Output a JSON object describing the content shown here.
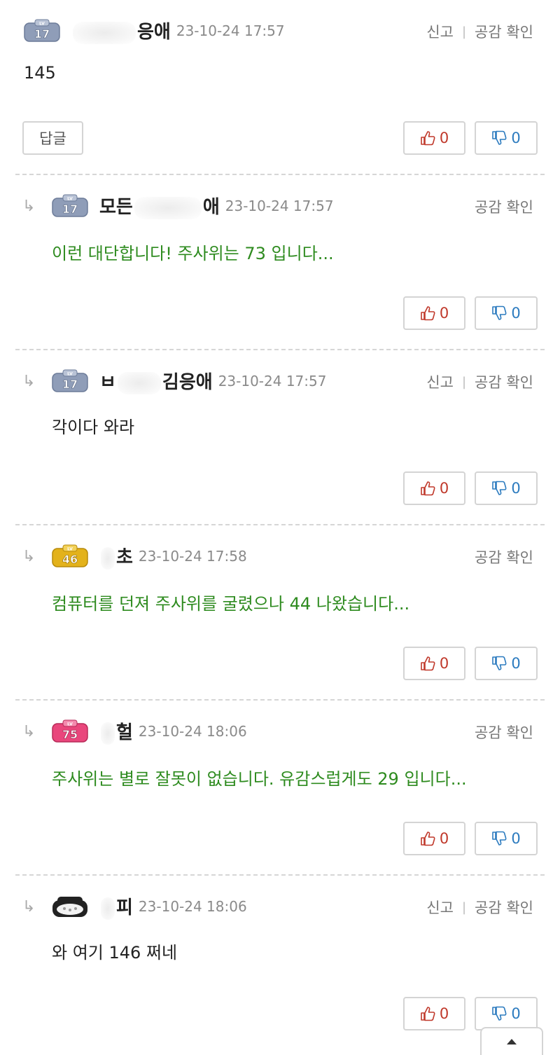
{
  "comments": [
    {
      "nick_left": "",
      "nick_right": "응애",
      "date": "23-10-24 17:57",
      "level": "17",
      "text": "145",
      "text_green": false,
      "actions": {
        "report": "신고",
        "separator": "|",
        "confirm": "공감 확인"
      },
      "reply_label": "답글",
      "likes": "0",
      "dislikes": "0"
    },
    {
      "nick_left": "모든",
      "nick_right": "애",
      "date": "23-10-24 17:57",
      "level": "17",
      "text": "이런 대단합니다! 주사위는 73 입니다...",
      "text_green": true,
      "actions": {
        "confirm": "공감 확인"
      },
      "likes": "0",
      "dislikes": "0"
    },
    {
      "nick_left": "ㅂ",
      "nick_right": "김응애",
      "date": "23-10-24 17:57",
      "level": "17",
      "text": "각이다 와라",
      "text_green": false,
      "actions": {
        "report": "신고",
        "separator": "|",
        "confirm": "공감 확인"
      },
      "likes": "0",
      "dislikes": "0"
    },
    {
      "nick_left": "",
      "nick_right": "초",
      "date": "23-10-24 17:58",
      "level": "46",
      "text": "컴퓨터를 던져 주사위를 굴렸으나 44 나왔습니다...",
      "text_green": true,
      "actions": {
        "confirm": "공감 확인"
      },
      "likes": "0",
      "dislikes": "0"
    },
    {
      "nick_left": "",
      "nick_right": "헐",
      "date": "23-10-24 18:06",
      "level": "75",
      "text": "주사위는 별로 잘못이 없습니다. 유감스럽게도 29 입니다...",
      "text_green": true,
      "actions": {
        "confirm": "공감 확인"
      },
      "likes": "0",
      "dislikes": "0"
    },
    {
      "nick_left": "",
      "nick_right": "피",
      "date": "23-10-24 18:06",
      "level": "",
      "text": "와 여기 146 쩌네",
      "text_green": false,
      "actions": {
        "report": "신고",
        "separator": "|",
        "confirm": "공감 확인"
      },
      "likes": "0",
      "dislikes": "0"
    }
  ],
  "reply_arrow": "↳",
  "colors": {
    "green_text": "#2e8b1f",
    "like_red": "#c0392b",
    "dislike_blue": "#2c7bbf",
    "badge_gray": "#8f9db8",
    "badge_gold": "#e3b21b",
    "badge_pink": "#e9467c"
  },
  "icons": {
    "like": "thumbs-up-icon",
    "dislike": "thumbs-down-icon",
    "scroll_top": "chevron-up-icon",
    "level_badge": "level-badge-icon"
  }
}
